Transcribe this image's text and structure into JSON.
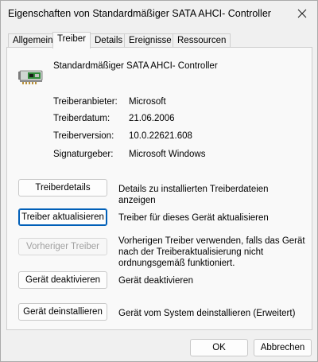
{
  "window": {
    "title": "Eigenschaften von Standardmäßiger SATA AHCI- Controller"
  },
  "tabs": [
    {
      "label": "Allgemein"
    },
    {
      "label": "Treiber"
    },
    {
      "label": "Details"
    },
    {
      "label": "Ereignisse"
    },
    {
      "label": "Ressourcen"
    }
  ],
  "device": {
    "name": "Standardmäßiger SATA AHCI- Controller",
    "icon": "disk-controller-icon"
  },
  "properties": [
    {
      "label": "Treiberanbieter:",
      "value": "Microsoft"
    },
    {
      "label": "Treiberdatum:",
      "value": "21.06.2006"
    },
    {
      "label": "Treiberversion:",
      "value": "10.0.22621.608"
    },
    {
      "label": "Signaturgeber:",
      "value": "Microsoft Windows"
    }
  ],
  "actions": [
    {
      "label": "Treiberdetails",
      "description": "Details zu installierten Treiberdateien anzeigen"
    },
    {
      "label": "Treiber aktualisieren",
      "description": "Treiber für dieses Gerät aktualisieren"
    },
    {
      "label": "Vorheriger Treiber",
      "description": "Vorherigen Treiber verwenden, falls das Gerät nach der Treiberaktualisierung nicht ordnungsgemäß funktioniert."
    },
    {
      "label": "Gerät deaktivieren",
      "description": "Gerät deaktivieren"
    },
    {
      "label": "Gerät deinstallieren",
      "description": "Gerät vom System deinstallieren (Erweitert)"
    }
  ],
  "footer": {
    "ok_label": "OK",
    "cancel_label": "Abbrechen"
  },
  "colors": {
    "background": "#f0f0f0",
    "panel": "#f9f9f9",
    "focus_border": "#005fb8",
    "disabled_text": "#a0a0a0"
  }
}
